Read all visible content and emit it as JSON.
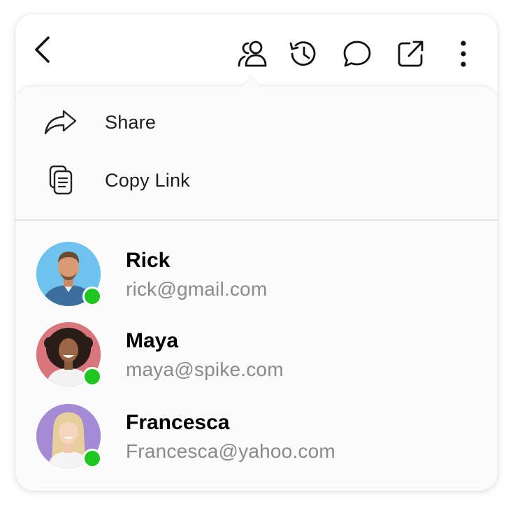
{
  "toolbar": {
    "icons": [
      "back-arrow-icon",
      "people-icon",
      "history-icon",
      "comment-icon",
      "open-external-icon",
      "more-vertical-icon"
    ]
  },
  "share_menu": {
    "items": [
      {
        "icon": "share-arrow-icon",
        "label": "Share"
      },
      {
        "icon": "copy-document-icon",
        "label": "Copy Link"
      }
    ]
  },
  "contacts": [
    {
      "name": "Rick",
      "email": "rick@gmail.com",
      "online": true,
      "avatar_bg": "#6ec3ee"
    },
    {
      "name": "Maya",
      "email": "maya@spike.com",
      "online": true,
      "avatar_bg": "#d9757d"
    },
    {
      "name": "Francesca",
      "email": "Francesca@yahoo.com",
      "online": true,
      "avatar_bg": "#a58ad6"
    }
  ],
  "colors": {
    "online_indicator": "#1fc61f",
    "email_text": "#8a8a8e",
    "panel_bg": "#fbfbfc"
  }
}
